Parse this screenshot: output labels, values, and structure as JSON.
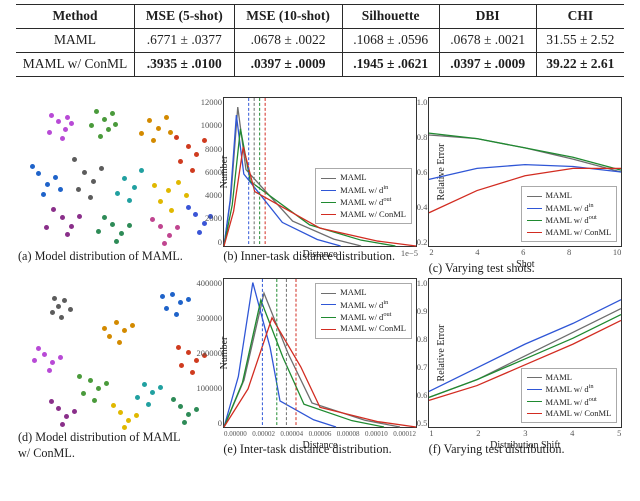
{
  "table": {
    "headers": [
      "Method",
      "MSE (5-shot)",
      "MSE (10-shot)",
      "Silhouette",
      "DBI",
      "CHI"
    ],
    "rows": [
      {
        "method": "MAML",
        "mse5": ".6771 ± .0377",
        "mse10": ".0678 ± .0022",
        "sil": ".1068 ± .0596",
        "dbi": ".0678 ± .0021",
        "chi": "31.55 ± 2.52",
        "bold": false
      },
      {
        "method": "MAML w/ ConML",
        "mse5": ".3935 ± .0100",
        "mse10": ".0397 ± .0009",
        "sil": ".1945 ± .0621",
        "dbi": ".0397 ± .0009",
        "chi": "39.22 ± 2.61",
        "bold": true
      }
    ]
  },
  "captions": {
    "a": "(a)  Model distribution of MAML.",
    "b": "(b)  Inner-task distance distribution.",
    "c": "(c)  Varying test shots.",
    "d_line1": "(d)  Model distribution of MAML",
    "d_line2": "w/ ConML.",
    "e": "(e)  Inter-task distance distribution.",
    "f": "(f)  Varying test distribution."
  },
  "legend_labels": {
    "maml": "MAML",
    "din": "MAML w/ d",
    "din_sup": "in",
    "dout": "MAML w/ d",
    "dout_sup": "out",
    "conml": "MAML w/ ConML"
  },
  "axis_labels": {
    "number": "Number",
    "distance": "Distance",
    "rel_error": "Relative Error",
    "shot": "Shot",
    "dist_shift": "Distribution Shift",
    "b_exp": "1e−5",
    "e_exp": ""
  },
  "chart_data": [
    {
      "id": "a",
      "type": "scatter",
      "title": "Model distribution of MAML",
      "note": "t-SNE style colored clusters, loosely spread; axes hidden",
      "clusters": [
        {
          "color": "#b84ad6",
          "points": [
            [
              38,
              22
            ],
            [
              45,
              30
            ],
            [
              31,
              16
            ],
            [
              51,
              24
            ],
            [
              42,
              39
            ],
            [
              29,
              33
            ],
            [
              47,
              18
            ]
          ]
        },
        {
          "color": "#4a9a3b",
          "points": [
            [
              76,
              12
            ],
            [
              84,
              20
            ],
            [
              92,
              14
            ],
            [
              71,
              26
            ],
            [
              88,
              30
            ],
            [
              80,
              37
            ],
            [
              95,
              25
            ]
          ]
        },
        {
          "color": "#d38a00",
          "points": [
            [
              129,
              21
            ],
            [
              138,
              29
            ],
            [
              121,
              34
            ],
            [
              146,
              18
            ],
            [
              133,
              41
            ],
            [
              150,
              33
            ]
          ]
        },
        {
          "color": "#cf3b1f",
          "points": [
            [
              168,
              47
            ],
            [
              160,
              62
            ],
            [
              176,
              55
            ],
            [
              184,
              41
            ],
            [
              172,
              71
            ],
            [
              156,
              38
            ]
          ]
        },
        {
          "color": "#1f63c9",
          "points": [
            [
              18,
              74
            ],
            [
              27,
              85
            ],
            [
              12,
              67
            ],
            [
              35,
              78
            ],
            [
              23,
              95
            ],
            [
              40,
              90
            ]
          ]
        },
        {
          "color": "#5c5c5c",
          "points": [
            [
              64,
              73
            ],
            [
              73,
              82
            ],
            [
              58,
              90
            ],
            [
              81,
              69
            ],
            [
              70,
              98
            ],
            [
              54,
              60
            ]
          ]
        },
        {
          "color": "#21a0a0",
          "points": [
            [
              104,
              79
            ],
            [
              114,
              88
            ],
            [
              97,
              94
            ],
            [
              121,
              71
            ],
            [
              109,
              101
            ]
          ]
        },
        {
          "color": "#e0b800",
          "points": [
            [
              148,
              91
            ],
            [
              140,
              102
            ],
            [
              158,
              83
            ],
            [
              166,
              96
            ],
            [
              151,
              111
            ],
            [
              134,
              86
            ]
          ]
        },
        {
          "color": "#8a2f8a",
          "points": [
            [
              42,
              118
            ],
            [
              51,
              127
            ],
            [
              33,
              110
            ],
            [
              59,
              117
            ],
            [
              47,
              135
            ],
            [
              26,
              128
            ]
          ]
        },
        {
          "color": "#2e8b57",
          "points": [
            [
              92,
              125
            ],
            [
              101,
              134
            ],
            [
              84,
              118
            ],
            [
              109,
              126
            ],
            [
              96,
              142
            ],
            [
              78,
              132
            ]
          ]
        },
        {
          "color": "#c04590",
          "points": [
            [
              140,
              127
            ],
            [
              149,
              136
            ],
            [
              132,
              120
            ],
            [
              157,
              128
            ],
            [
              144,
              144
            ]
          ]
        },
        {
          "color": "#3a55d6",
          "points": [
            [
              175,
              115
            ],
            [
              184,
              124
            ],
            [
              168,
              108
            ],
            [
              190,
              117
            ],
            [
              179,
              133
            ]
          ]
        }
      ]
    },
    {
      "id": "d",
      "type": "scatter",
      "title": "Model distribution of MAML w/ ConML",
      "note": "t-SNE style colored clusters, tightly grouped; axes hidden",
      "clusters": [
        {
          "color": "#5c5c5c",
          "points": [
            [
              38,
              26
            ],
            [
              44,
              20
            ],
            [
              32,
              32
            ],
            [
              50,
              29
            ],
            [
              41,
              37
            ],
            [
              34,
              18
            ]
          ]
        },
        {
          "color": "#1f63c9",
          "points": [
            [
              152,
              14
            ],
            [
              160,
              22
            ],
            [
              146,
              28
            ],
            [
              168,
              19
            ],
            [
              156,
              34
            ],
            [
              142,
              16
            ]
          ]
        },
        {
          "color": "#d38a00",
          "points": [
            [
              96,
              42
            ],
            [
              104,
              50
            ],
            [
              89,
              56
            ],
            [
              112,
              45
            ],
            [
              99,
              62
            ],
            [
              84,
              48
            ]
          ]
        },
        {
          "color": "#b84ad6",
          "points": [
            [
              24,
              74
            ],
            [
              32,
              82
            ],
            [
              18,
              68
            ],
            [
              40,
              77
            ],
            [
              29,
              90
            ],
            [
              14,
              80
            ]
          ]
        },
        {
          "color": "#cf3b1f",
          "points": [
            [
              168,
              72
            ],
            [
              176,
              80
            ],
            [
              161,
              85
            ],
            [
              184,
              75
            ],
            [
              172,
              92
            ],
            [
              158,
              67
            ]
          ]
        },
        {
          "color": "#4a9a3b",
          "points": [
            [
              70,
              100
            ],
            [
              78,
              108
            ],
            [
              63,
              113
            ],
            [
              86,
              103
            ],
            [
              74,
              120
            ],
            [
              59,
              96
            ]
          ]
        },
        {
          "color": "#21a0a0",
          "points": [
            [
              124,
              104
            ],
            [
              132,
              112
            ],
            [
              117,
              117
            ],
            [
              140,
              107
            ],
            [
              128,
              124
            ]
          ]
        },
        {
          "color": "#8a2f8a",
          "points": [
            [
              38,
              128
            ],
            [
              46,
              136
            ],
            [
              31,
              121
            ],
            [
              54,
              131
            ],
            [
              42,
              144
            ]
          ]
        },
        {
          "color": "#e0b800",
          "points": [
            [
              100,
              132
            ],
            [
              108,
              140
            ],
            [
              93,
              125
            ],
            [
              116,
              135
            ],
            [
              104,
              147
            ]
          ]
        },
        {
          "color": "#2e8b57",
          "points": [
            [
              160,
              126
            ],
            [
              168,
              134
            ],
            [
              153,
              119
            ],
            [
              176,
              129
            ],
            [
              164,
              142
            ]
          ]
        }
      ]
    },
    {
      "id": "b",
      "type": "area",
      "title": "Inner-task distance distribution",
      "xlabel": "Distance",
      "ylabel": "Number",
      "xlim": [
        0,
        1.4e-05
      ],
      "ylim": [
        0,
        13000
      ],
      "x_ticks": [
        "",
        "",
        "",
        "",
        "",
        "",
        ""
      ],
      "y_ticks": [
        "12000",
        "10000",
        "8000",
        "6000",
        "4000",
        "2000",
        "0"
      ],
      "vlines": {
        "maml": 2.2e-06,
        "din": 1.8e-06,
        "dout": 2.6e-06,
        "conml": 3e-06
      },
      "series": [
        {
          "name": "MAML",
          "peak_x": 1e-06,
          "peak_y": 12200,
          "tail": 1e-05
        },
        {
          "name": "MAML w/ d^in",
          "peak_x": 9e-07,
          "peak_y": 11500,
          "tail": 8.5e-06
        },
        {
          "name": "MAML w/ d^out",
          "peak_x": 1.2e-06,
          "peak_y": 10300,
          "tail": 1.25e-05
        },
        {
          "name": "MAML w/ ConML",
          "peak_x": 1.4e-06,
          "peak_y": 8700,
          "tail": 1.4e-05
        }
      ]
    },
    {
      "id": "e",
      "type": "area",
      "title": "Inter-task distance distribution",
      "xlabel": "Distance",
      "ylabel": "Number",
      "xlim": [
        0,
        0.00012
      ],
      "ylim": [
        0,
        420000
      ],
      "x_ticks": [
        "0.00000",
        "0.00002",
        "0.00004",
        "0.00006",
        "0.00008",
        "0.00010",
        "0.00012"
      ],
      "y_ticks": [
        "400000",
        "300000",
        "200000",
        "100000",
        "0"
      ],
      "vlines": {
        "maml": 3.9e-05,
        "din": 2.4e-05,
        "dout": 3.3e-05,
        "conml": 4.5e-05
      },
      "series": [
        {
          "name": "MAML",
          "peak_x": 2.5e-05,
          "peak_y": 380000,
          "tail": 0.00011
        },
        {
          "name": "MAML w/ d^in",
          "peak_x": 1.8e-05,
          "peak_y": 410000,
          "tail": 7e-05
        },
        {
          "name": "MAML w/ d^out",
          "peak_x": 2.3e-05,
          "peak_y": 360000,
          "tail": 0.0001
        },
        {
          "name": "MAML w/ ConML",
          "peak_x": 3e-05,
          "peak_y": 310000,
          "tail": 0.00012
        }
      ]
    },
    {
      "id": "c",
      "type": "line",
      "title": "Varying test shots",
      "xlabel": "Shot",
      "ylabel": "Relative Error",
      "x": [
        2,
        4,
        6,
        8,
        10
      ],
      "ylim": [
        0.2,
        1.0
      ],
      "y_ticks": [
        "1.0",
        "0.8",
        "0.6",
        "0.4",
        "0.2"
      ],
      "series": [
        {
          "name": "MAML",
          "y": [
            0.8,
            0.78,
            0.73,
            0.67,
            0.6
          ]
        },
        {
          "name": "MAML w/ d^in",
          "y": [
            0.56,
            0.62,
            0.64,
            0.63,
            0.6
          ]
        },
        {
          "name": "MAML w/ d^out",
          "y": [
            0.81,
            0.78,
            0.73,
            0.68,
            0.61
          ]
        },
        {
          "name": "MAML w/ ConML",
          "y": [
            0.38,
            0.5,
            0.58,
            0.62,
            0.62
          ]
        }
      ]
    },
    {
      "id": "f",
      "type": "line",
      "title": "Varying test distribution",
      "xlabel": "Distribution Shift",
      "ylabel": "Relative Error",
      "x": [
        1,
        2,
        3,
        4,
        5
      ],
      "ylim": [
        0.5,
        1.0
      ],
      "y_ticks": [
        "1.0",
        "0.9",
        "0.8",
        "0.7",
        "0.6",
        "0.5"
      ],
      "series": [
        {
          "name": "MAML",
          "y": [
            0.6,
            0.66,
            0.74,
            0.82,
            0.9
          ]
        },
        {
          "name": "MAML w/ d^in",
          "y": [
            0.62,
            0.7,
            0.78,
            0.85,
            0.93
          ]
        },
        {
          "name": "MAML w/ d^out",
          "y": [
            0.6,
            0.66,
            0.73,
            0.8,
            0.88
          ]
        },
        {
          "name": "MAML w/ ConML",
          "y": [
            0.59,
            0.64,
            0.71,
            0.78,
            0.86
          ]
        }
      ]
    }
  ]
}
